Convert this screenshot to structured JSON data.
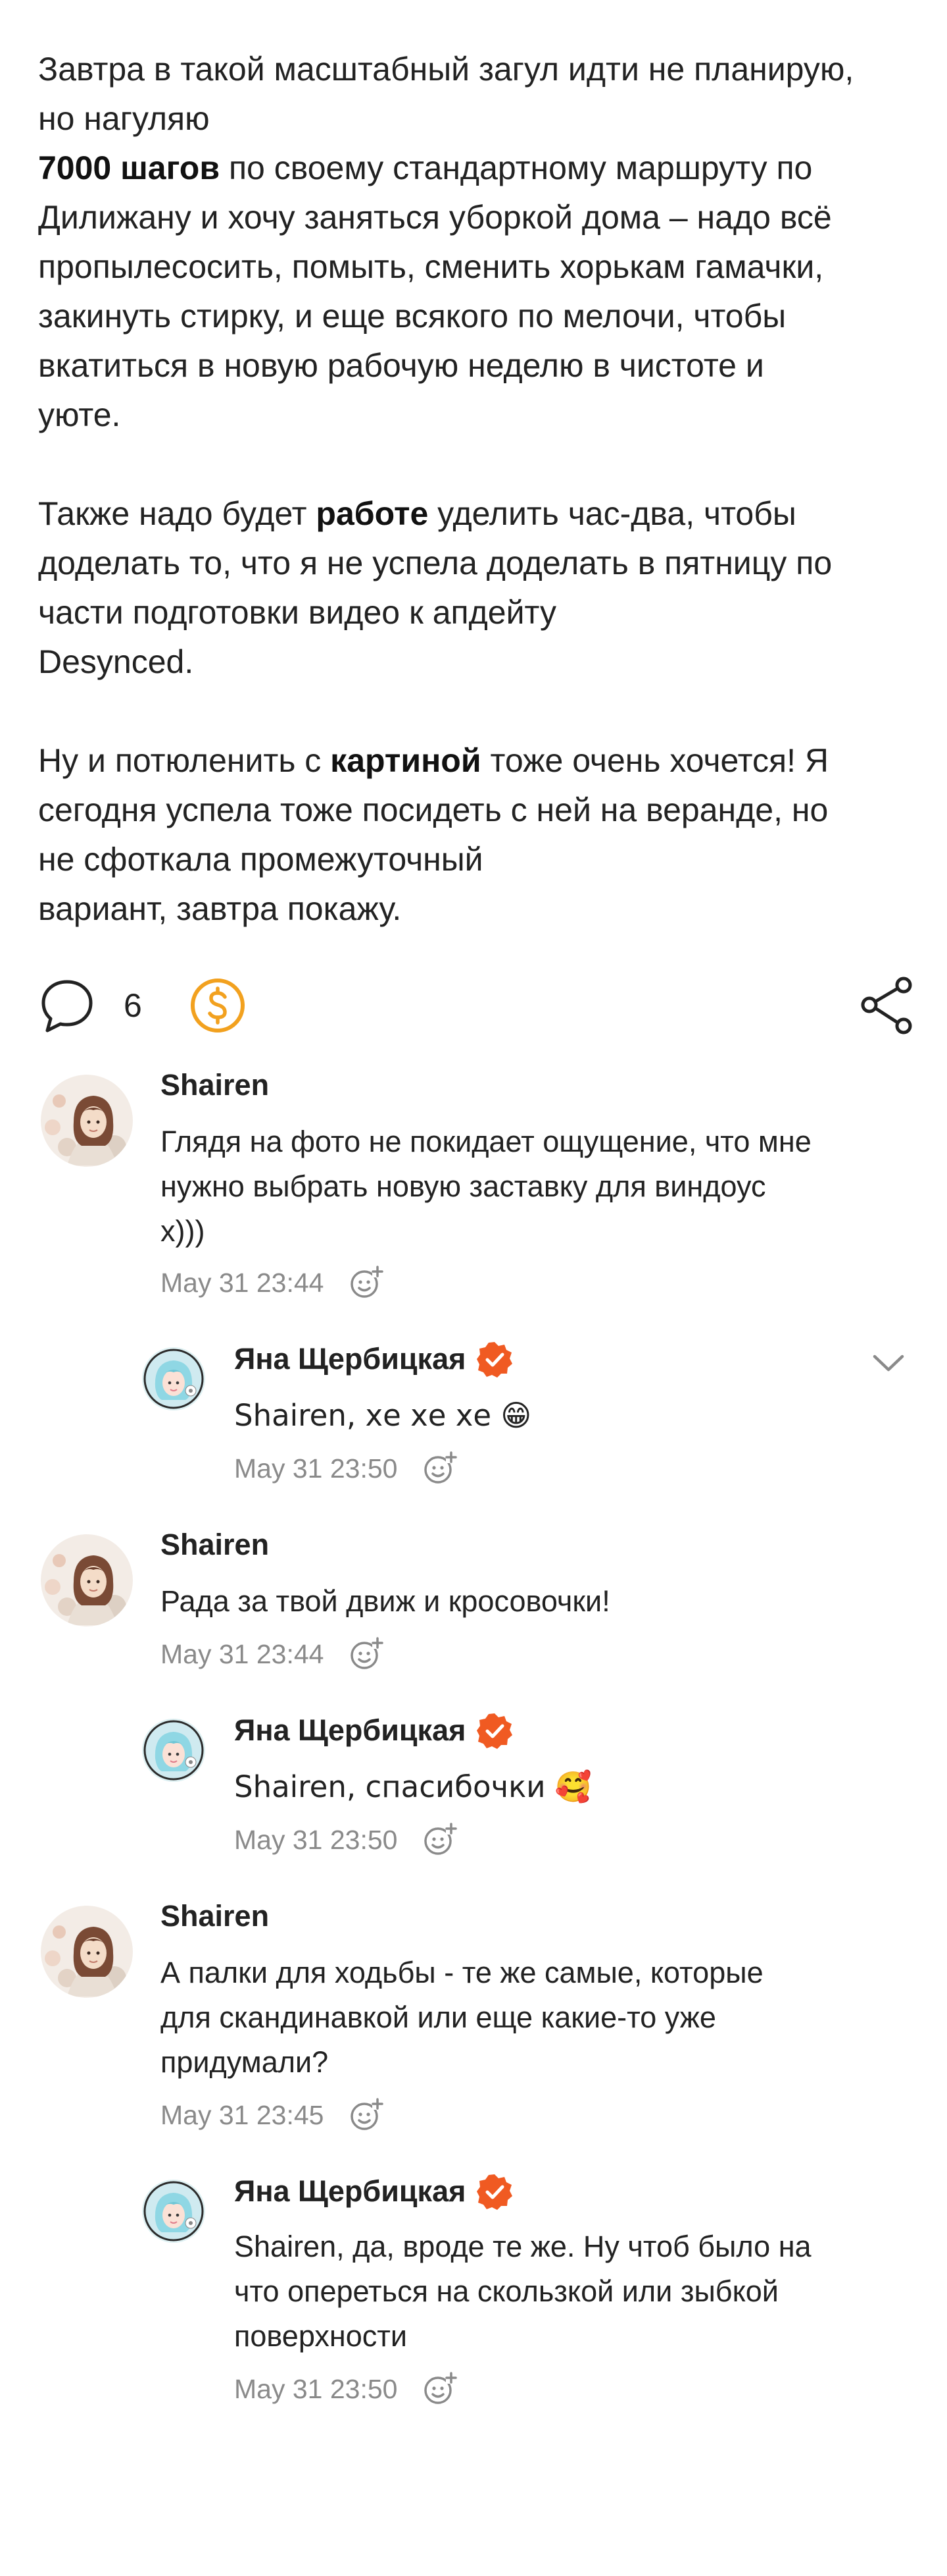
{
  "post": {
    "p1": {
      "line1": "Завтра в такой масштабный загул идти не планирую,",
      "line2": "но нагуляю",
      "bold": "7000 шагов",
      "rest_l3": " по своему стандартному маршруту по",
      "line4": "Дилижану и хочу заняться уборкой дома – надо всё",
      "line5": "пропылесосить, помыть, сменить хорькам гамачки,",
      "line6": "закинуть стирку, и еще всякого по мелочи, чтобы",
      "line7": "вкатиться в новую рабочую неделю в чистоте и",
      "line8": "уюте."
    },
    "p2": {
      "pre": "Также надо будет ",
      "bold": "работе",
      "post": " уделить час-два, чтобы",
      "line2": "доделать то, что я не успела доделать в пятницу по",
      "line3": "части подготовки видео к апдейту",
      "line4": "Desynced."
    },
    "p3": {
      "pre": "Ну и потюленить с ",
      "bold": "картиной",
      "post": " тоже очень хочется! Я",
      "line2": "сегодня успела тоже посидеть с ней на веранде, но",
      "line3": "не сфоткала промежуточный",
      "line4": "вариант, завтра покажу."
    }
  },
  "actions": {
    "comments_icon": "speech-bubble-icon",
    "comments_count": "6",
    "donate_icon": "dollar-coin-icon",
    "share_icon": "share-icon"
  },
  "colors": {
    "accent_orange": "#f2a11f",
    "verified_orange": "#f05a22",
    "meta_gray": "#8a8a8a",
    "text": "#222222"
  },
  "comments": [
    {
      "author": "Shairen",
      "text_lines": [
        "Глядя на фото не покидает ощущение, что мне",
        "нужно выбрать новую заставку для виндоус",
        "х)))"
      ],
      "time": "May 31 23:44",
      "reply": {
        "author": "Яна Щербицкая",
        "text": "Shairen, хе хе хе 😁",
        "time": "May 31 23:50"
      }
    },
    {
      "author": "Shairen",
      "text_lines": [
        "Рада за твой движ и кросовочки!"
      ],
      "time": "May 31 23:44",
      "reply": {
        "author": "Яна Щербицкая",
        "text": "Shairen, спасибочки 🥰",
        "time": "May 31 23:50"
      }
    },
    {
      "author": "Shairen",
      "text_lines": [
        "А палки для ходьбы - те же самые, которые",
        "для скандинавкой или еще какие-то уже",
        "придумали?"
      ],
      "time": "May 31 23:45",
      "reply": {
        "author": "Яна Щербицкая",
        "text_lines": [
          "Shairen, да, вроде те же. Ну чтоб было на",
          "что опереться на скользкой или зыбкой",
          "поверхности"
        ],
        "time": "May 31 23:50"
      }
    }
  ]
}
